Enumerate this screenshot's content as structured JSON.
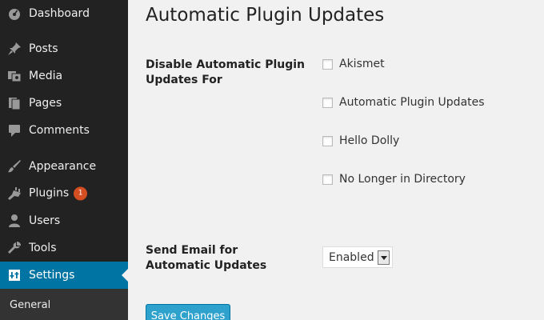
{
  "sidebar": {
    "items": [
      {
        "label": "Dashboard",
        "icon": "dashboard-icon"
      },
      {
        "label": "Posts",
        "icon": "pin-icon"
      },
      {
        "label": "Media",
        "icon": "media-icon"
      },
      {
        "label": "Pages",
        "icon": "pages-icon"
      },
      {
        "label": "Comments",
        "icon": "comment-icon"
      },
      {
        "label": "Appearance",
        "icon": "brush-icon"
      },
      {
        "label": "Plugins",
        "icon": "plug-icon",
        "badge": "1"
      },
      {
        "label": "Users",
        "icon": "user-icon"
      },
      {
        "label": "Tools",
        "icon": "wrench-icon"
      },
      {
        "label": "Settings",
        "icon": "settings-icon",
        "active": true
      }
    ],
    "submenu": {
      "label": "General"
    }
  },
  "main": {
    "title": "Automatic Plugin Updates",
    "disable_label": "Disable Automatic Plugin Updates For",
    "plugins": [
      "Akismet",
      "Automatic Plugin Updates",
      "Hello Dolly",
      "No Longer in Directory"
    ],
    "email_label": "Send Email for Automatic Updates",
    "email_select": {
      "selected": "Enabled"
    },
    "save_label": "Save Changes"
  },
  "colors": {
    "sidebar_bg": "#222222",
    "active_bg": "#0074a2",
    "badge": "#d54e21",
    "button": "#2ea2cc"
  }
}
